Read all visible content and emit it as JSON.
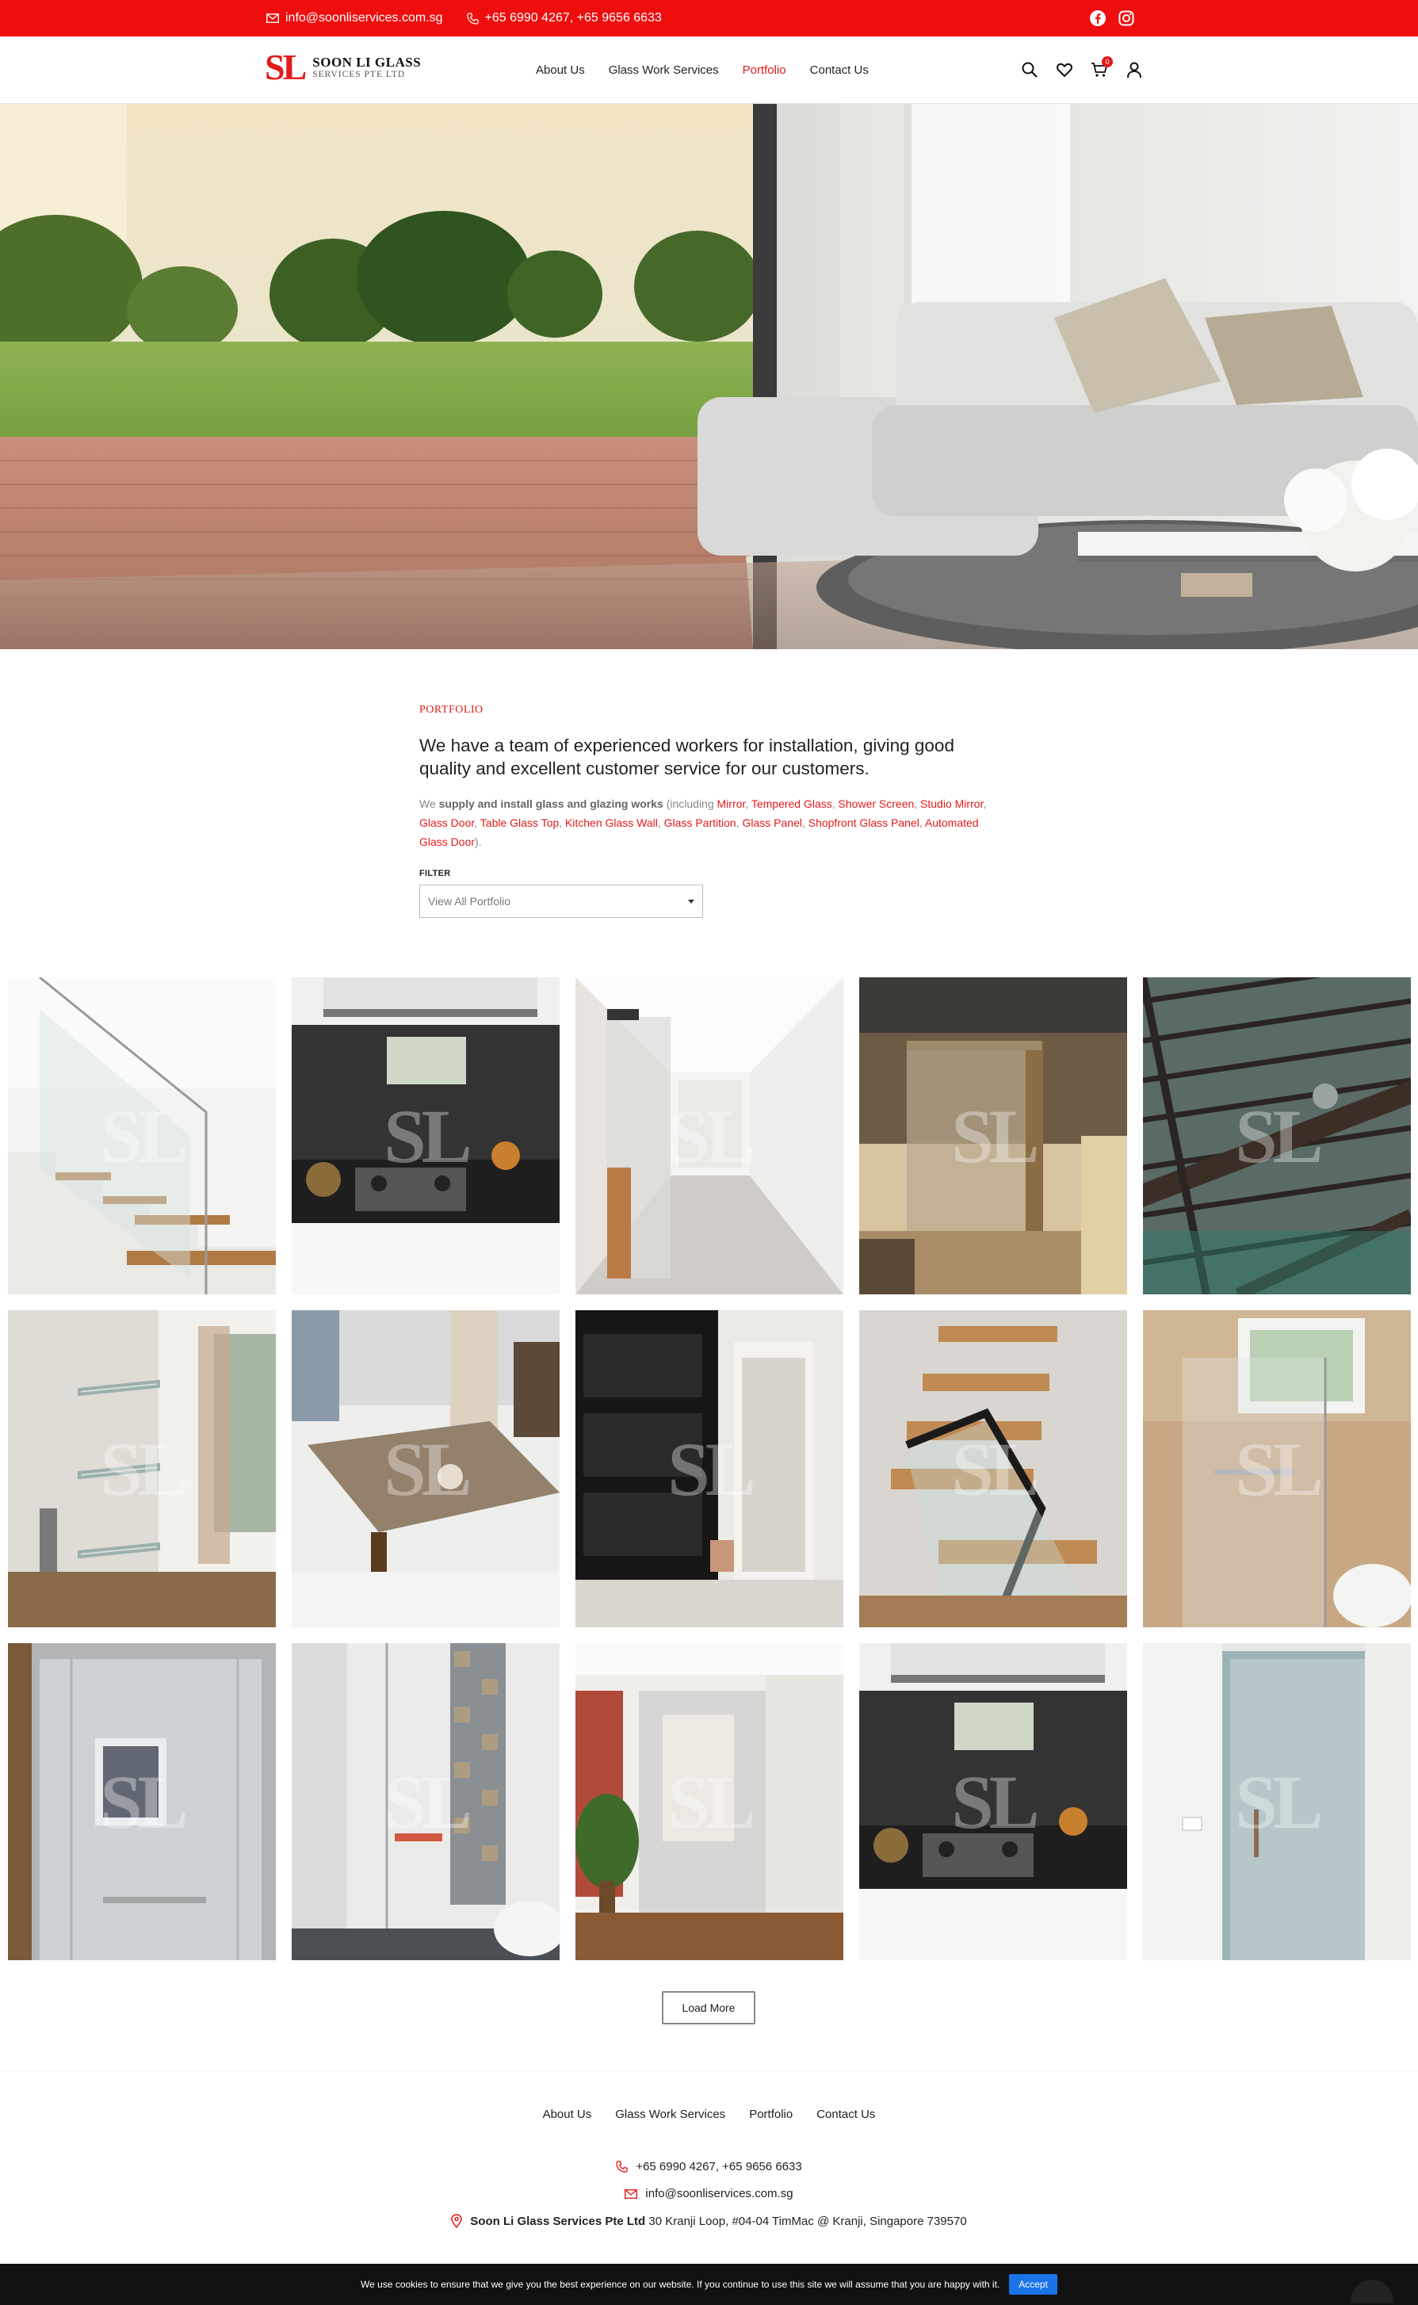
{
  "topbar": {
    "email": "info@soonliservices.com.sg",
    "phones": "+65 6990 4267, +65 9656 6633",
    "social": [
      "facebook-icon",
      "instagram-icon"
    ],
    "bg_color": "#ee0e0e"
  },
  "header": {
    "logo_mark": "SL",
    "logo_line1": "SOON LI GLASS",
    "logo_line2": "SERVICES PTE LTD",
    "nav": [
      "About Us",
      "Glass Work Services",
      "Portfolio",
      "Contact Us"
    ],
    "active_nav": "Portfolio",
    "cart_count": "0",
    "icons": [
      "search-icon",
      "heart-icon",
      "cart-icon",
      "user-icon"
    ]
  },
  "intro": {
    "eyebrow": "PORTFOLIO",
    "headline": "We have a team of experienced workers for installation, giving good quality and excellent customer service for our customers.",
    "desc_prefix": "We ",
    "desc_bold": "supply and install glass and glazing works",
    "desc_open": " (including ",
    "services": [
      "Mirror",
      "Tempered Glass",
      "Shower Screen",
      "Studio Mirror",
      "Glass Door",
      "Table Glass Top",
      "Kitchen Glass Wall",
      "Glass Partition",
      "Glass Panel",
      "Shopfront Glass Panel",
      "Automated Glass Door"
    ],
    "desc_close": ").",
    "filter_label": "FILTER",
    "filter_value": "View All Portfolio"
  },
  "portfolio": {
    "watermark": "SL",
    "tiles": [
      "staircase-glass-railing",
      "kitchen-glass-backsplash",
      "sliding-glass-door-corridor",
      "shopfront-glass-partition",
      "glass-roof-canopy",
      "glass-shelves",
      "glass-table-top",
      "glass-cabinet-doors",
      "glass-stair-balustrade",
      "shower-screen",
      "shower-enclosure",
      "shower-screen-tiled",
      "glass-partition-room",
      "kitchen-glass-backsplash-2",
      "frosted-glass-door"
    ]
  },
  "load_more": "Load More",
  "footer": {
    "nav": [
      "About Us",
      "Glass Work Services",
      "Portfolio",
      "Contact Us"
    ],
    "phones": "+65 6990 4267, +65 9656 6633",
    "email": "info@soonliservices.com.sg",
    "company": "Soon Li Glass Services Pte Ltd",
    "address": "30 Kranji Loop, #04-04 TimMac @ Kranji, Singapore 739570"
  },
  "cookie": {
    "text": "We use cookies to ensure that we give you the best experience on our website. If you continue to use this site we will assume that you are happy with it.",
    "accept": "Accept"
  },
  "colors": {
    "accent": "#e31b1b",
    "accept_button": "#1a73e8"
  }
}
